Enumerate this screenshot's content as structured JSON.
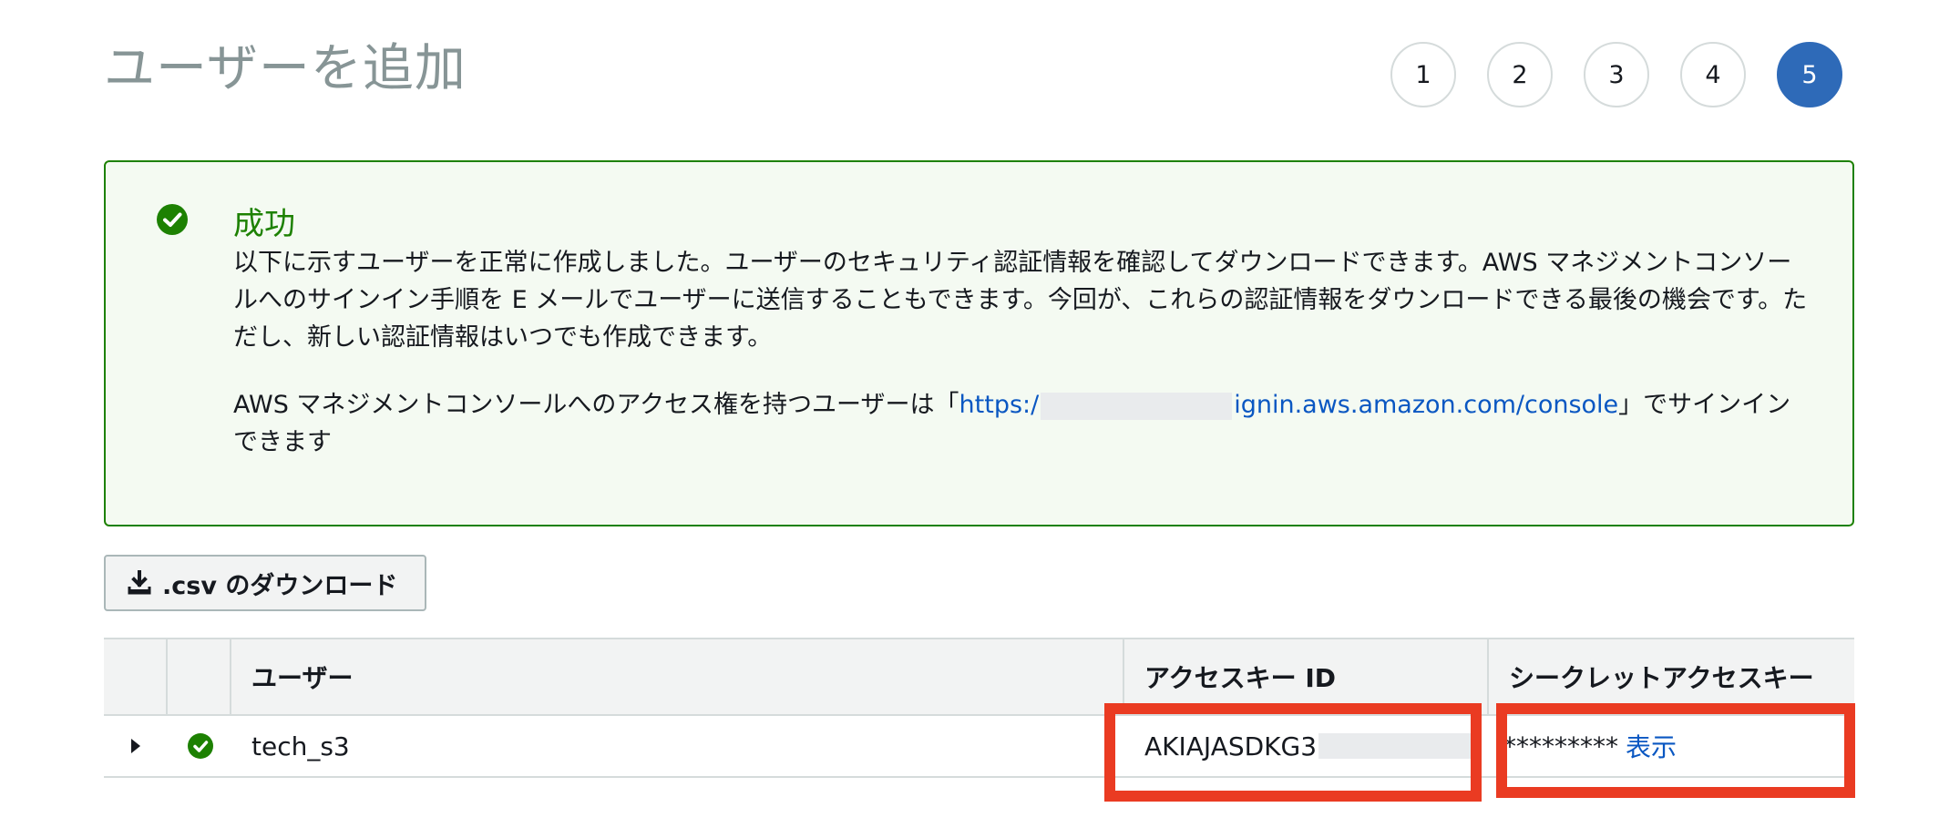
{
  "page": {
    "title": "ユーザーを追加"
  },
  "steps": [
    {
      "label": "1",
      "active": false
    },
    {
      "label": "2",
      "active": false
    },
    {
      "label": "3",
      "active": false
    },
    {
      "label": "4",
      "active": false
    },
    {
      "label": "5",
      "active": true
    }
  ],
  "alert": {
    "title": "成功",
    "message": "以下に示すユーザーを正常に作成しました。ユーザーのセキュリティ認証情報を確認してダウンロードできます。AWS マネジメントコンソールへのサインイン手順を E メールでユーザーに送信することもできます。今回が、これらの認証情報をダウンロードできる最後の機会です。ただし、新しい認証情報はいつでも作成できます。",
    "console_prefix": "AWS マネジメントコンソールへのアクセス権を持つユーザーは「",
    "console_url_start": "https:/",
    "console_url_end": "ignin.aws.amazon.com/console",
    "console_suffix": "」でサインインできます"
  },
  "download_button": {
    "label": ".csv のダウンロード"
  },
  "table": {
    "headers": [
      "",
      "",
      "ユーザー",
      "アクセスキー ID",
      "シークレットアクセスキー"
    ],
    "rows": [
      {
        "user": "tech_s3",
        "access_key_id": "AKIAJASDKG3",
        "secret_masked": "*********",
        "show_label": "表示"
      }
    ]
  },
  "colors": {
    "success": "#1d8102",
    "link": "#0a57c2",
    "step_active": "#2e6ab8",
    "highlight": "#ea3b22"
  },
  "icons": {
    "success": "check-circle-icon",
    "download": "download-icon",
    "expand": "caret-right-icon"
  }
}
